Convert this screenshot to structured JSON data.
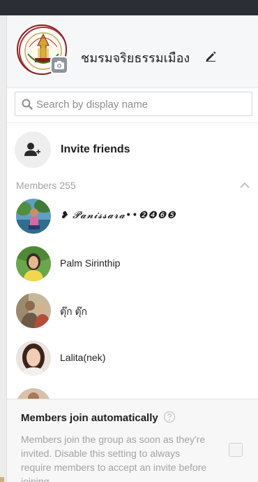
{
  "group": {
    "name": "ชมรมจริยธรรมเมือง",
    "avatar_icon": "group-seal-icon",
    "camera_icon": "camera-icon",
    "edit_icon": "pencil-icon"
  },
  "search": {
    "placeholder": "Search by display name",
    "value": ""
  },
  "invite": {
    "label": "Invite friends",
    "icon": "add-user-icon"
  },
  "members": {
    "label": "Members",
    "count": "255",
    "collapse_icon": "chevron-up-icon",
    "items": [
      {
        "name": "❥ 𝓟𝓪𝓷𝓲𝓼𝓼𝓪𝓻𝓪••❷❹❻❺"
      },
      {
        "name": "Palm Sirinthip"
      },
      {
        "name": "ตุ๊ก ตุ๊ก"
      },
      {
        "name": "Lalita(nek)"
      }
    ]
  },
  "settings": {
    "title": "Members join automatically",
    "description": "Members join the group as soon as they're invited. Disable this setting to always require members to accept an invite before joining.",
    "help_icon": "question-circle-icon",
    "checked": false
  },
  "colors": {
    "top_bar": "#2b2e36",
    "header_bg": "#f6f7f8",
    "muted_text": "#a3a3a3",
    "text": "#1e1e1e"
  }
}
